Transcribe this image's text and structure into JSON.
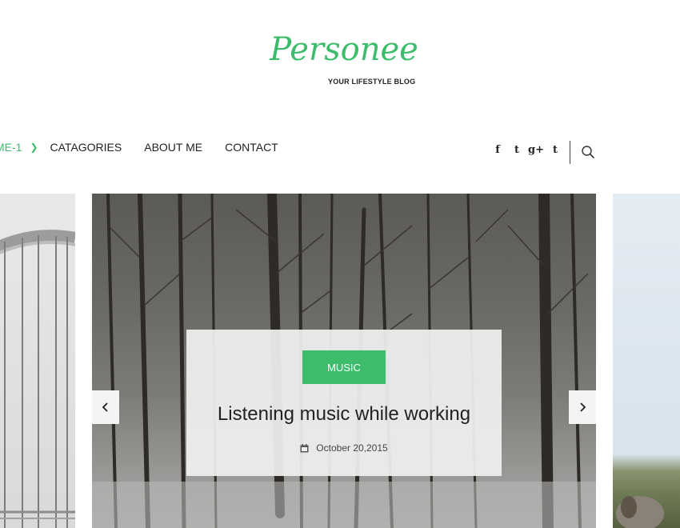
{
  "header": {
    "logo_text": "Personee",
    "tagline": "YOUR LIFESTYLE BLOG"
  },
  "nav": {
    "items": [
      {
        "label": "ME-1"
      },
      {
        "label": "CATAGORIES"
      },
      {
        "label": "ABOUT ME"
      },
      {
        "label": "CONTACT"
      }
    ]
  },
  "social": {
    "icons": [
      "facebook-icon",
      "twitter-icon",
      "google-plus-icon",
      "tumblr-icon"
    ],
    "glyphs": [
      "f",
      "t",
      "g+",
      "t"
    ]
  },
  "slider": {
    "category": "MUSIC",
    "title": "Listening music while working",
    "date": "October 20,2015"
  },
  "colors": {
    "accent": "#3dbd6b"
  }
}
